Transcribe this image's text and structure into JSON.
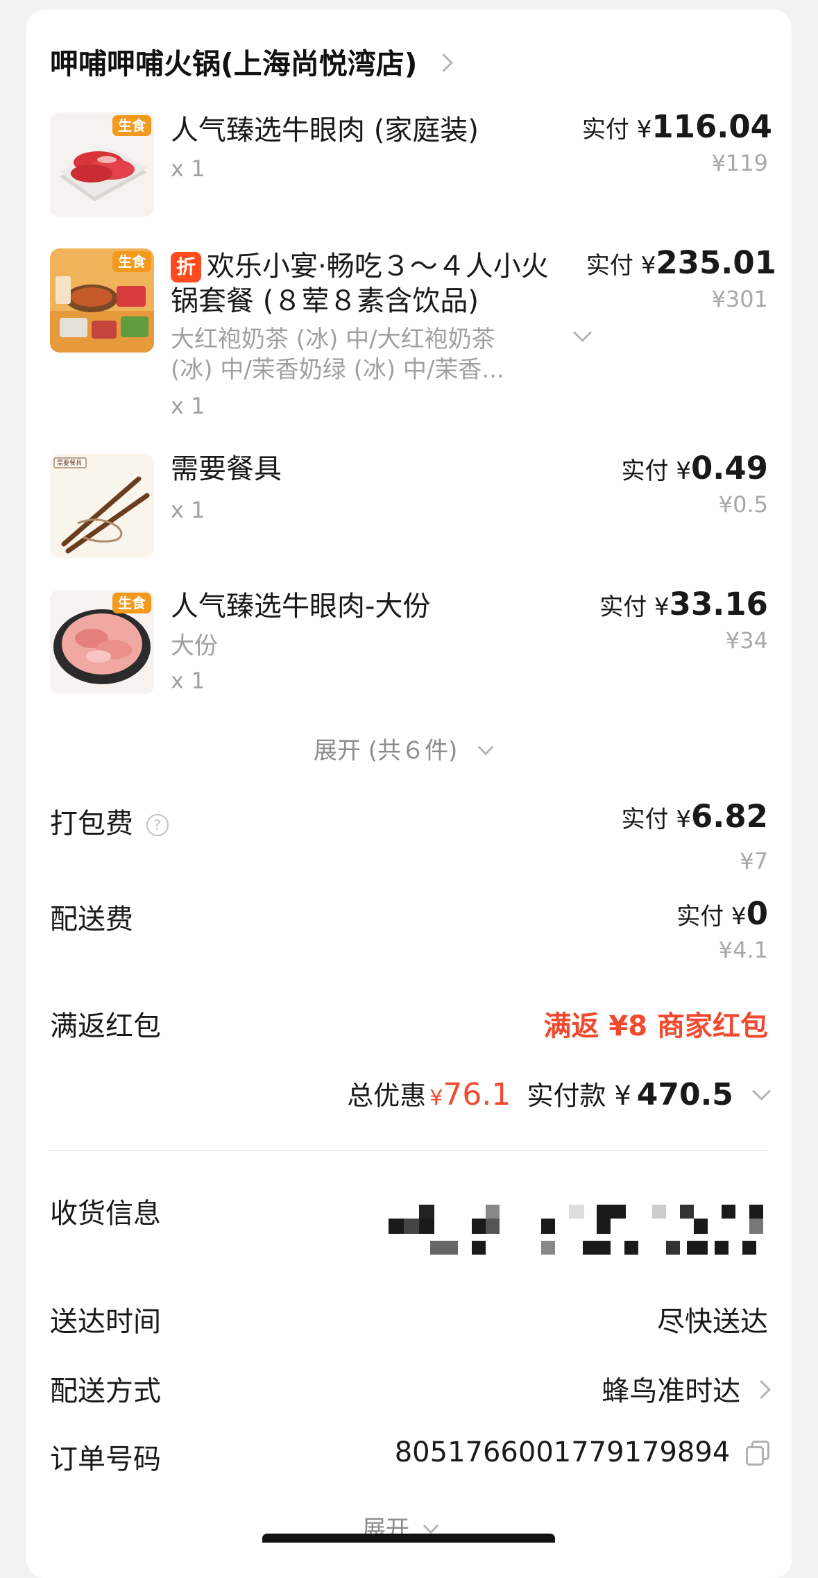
{
  "store": {
    "name": "呷哺呷哺火锅(上海尚悦湾店)"
  },
  "items": [
    {
      "tag": "生食",
      "name": "人气臻选牛眼肉 (家庭装)",
      "qty": "x 1",
      "paid_label": "实付 ¥",
      "paid": "116.04",
      "original": "¥119"
    },
    {
      "tag": "生食",
      "discount_badge": "折",
      "name_line1": "欢乐小宴·畅吃３～４人小火",
      "name_line2": "锅套餐 (８荤８素含饮品)",
      "sub_line1": "大红袍奶茶 (冰) 中/大红袍奶茶",
      "sub_line2": "(冰) 中/茉香奶绿 (冰) 中/茉香...",
      "qty": "x 1",
      "paid_label": "实付 ¥",
      "paid": "235.01",
      "original": "¥301"
    },
    {
      "thumb_label": "需要餐具",
      "name": "需要餐具",
      "qty": "x 1",
      "paid_label": "实付 ¥",
      "paid": "0.49",
      "original": "¥0.5"
    },
    {
      "tag": "生食",
      "name": "人气臻选牛眼肉-大份",
      "sub": "大份",
      "qty": "x 1",
      "paid_label": "实付 ¥",
      "paid": "33.16",
      "original": "¥34"
    }
  ],
  "expand_items": "展开 (共６件)",
  "packing": {
    "label": "打包费",
    "paid_label": "实付 ¥",
    "paid": "6.82",
    "original": "¥7"
  },
  "delivery_fee": {
    "label": "配送费",
    "paid_label": "实付 ¥",
    "paid": "0",
    "original": "¥4.1"
  },
  "red_packet": {
    "label": "满返红包",
    "value": "满返 ¥8 商家红包"
  },
  "summary": {
    "discount_label": "总优惠",
    "discount_currency": "¥",
    "discount": "76.1",
    "paid_label": "实付款 ¥",
    "paid": "470.5"
  },
  "info": {
    "receiver_label": "收货信息",
    "time_label": "送达时间",
    "time_value": "尽快送达",
    "method_label": "配送方式",
    "method_value": "蜂鸟准时达",
    "order_label": "订单号码",
    "order_value": "8051766001779179894",
    "expand": "展开"
  },
  "colors": {
    "accent_red": "#f04a2f",
    "tag_orange": "#f39a1e",
    "discount_badge": "#ff4b1e"
  }
}
